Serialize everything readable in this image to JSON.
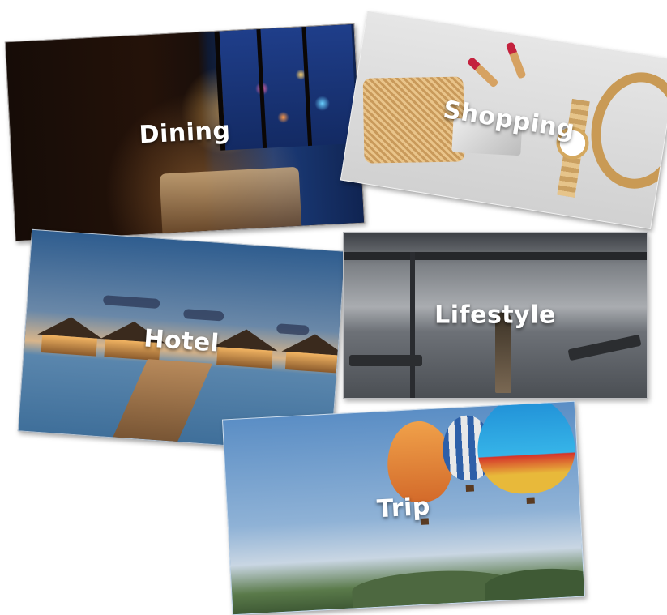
{
  "cards": [
    {
      "id": "dining",
      "label": "Dining"
    },
    {
      "id": "shopping",
      "label": "Shopping"
    },
    {
      "id": "hotel",
      "label": "Hotel"
    },
    {
      "id": "lifestyle",
      "label": "Lifestyle"
    },
    {
      "id": "trip",
      "label": "Trip"
    }
  ],
  "colors": {
    "label_text": "#ffffff"
  }
}
